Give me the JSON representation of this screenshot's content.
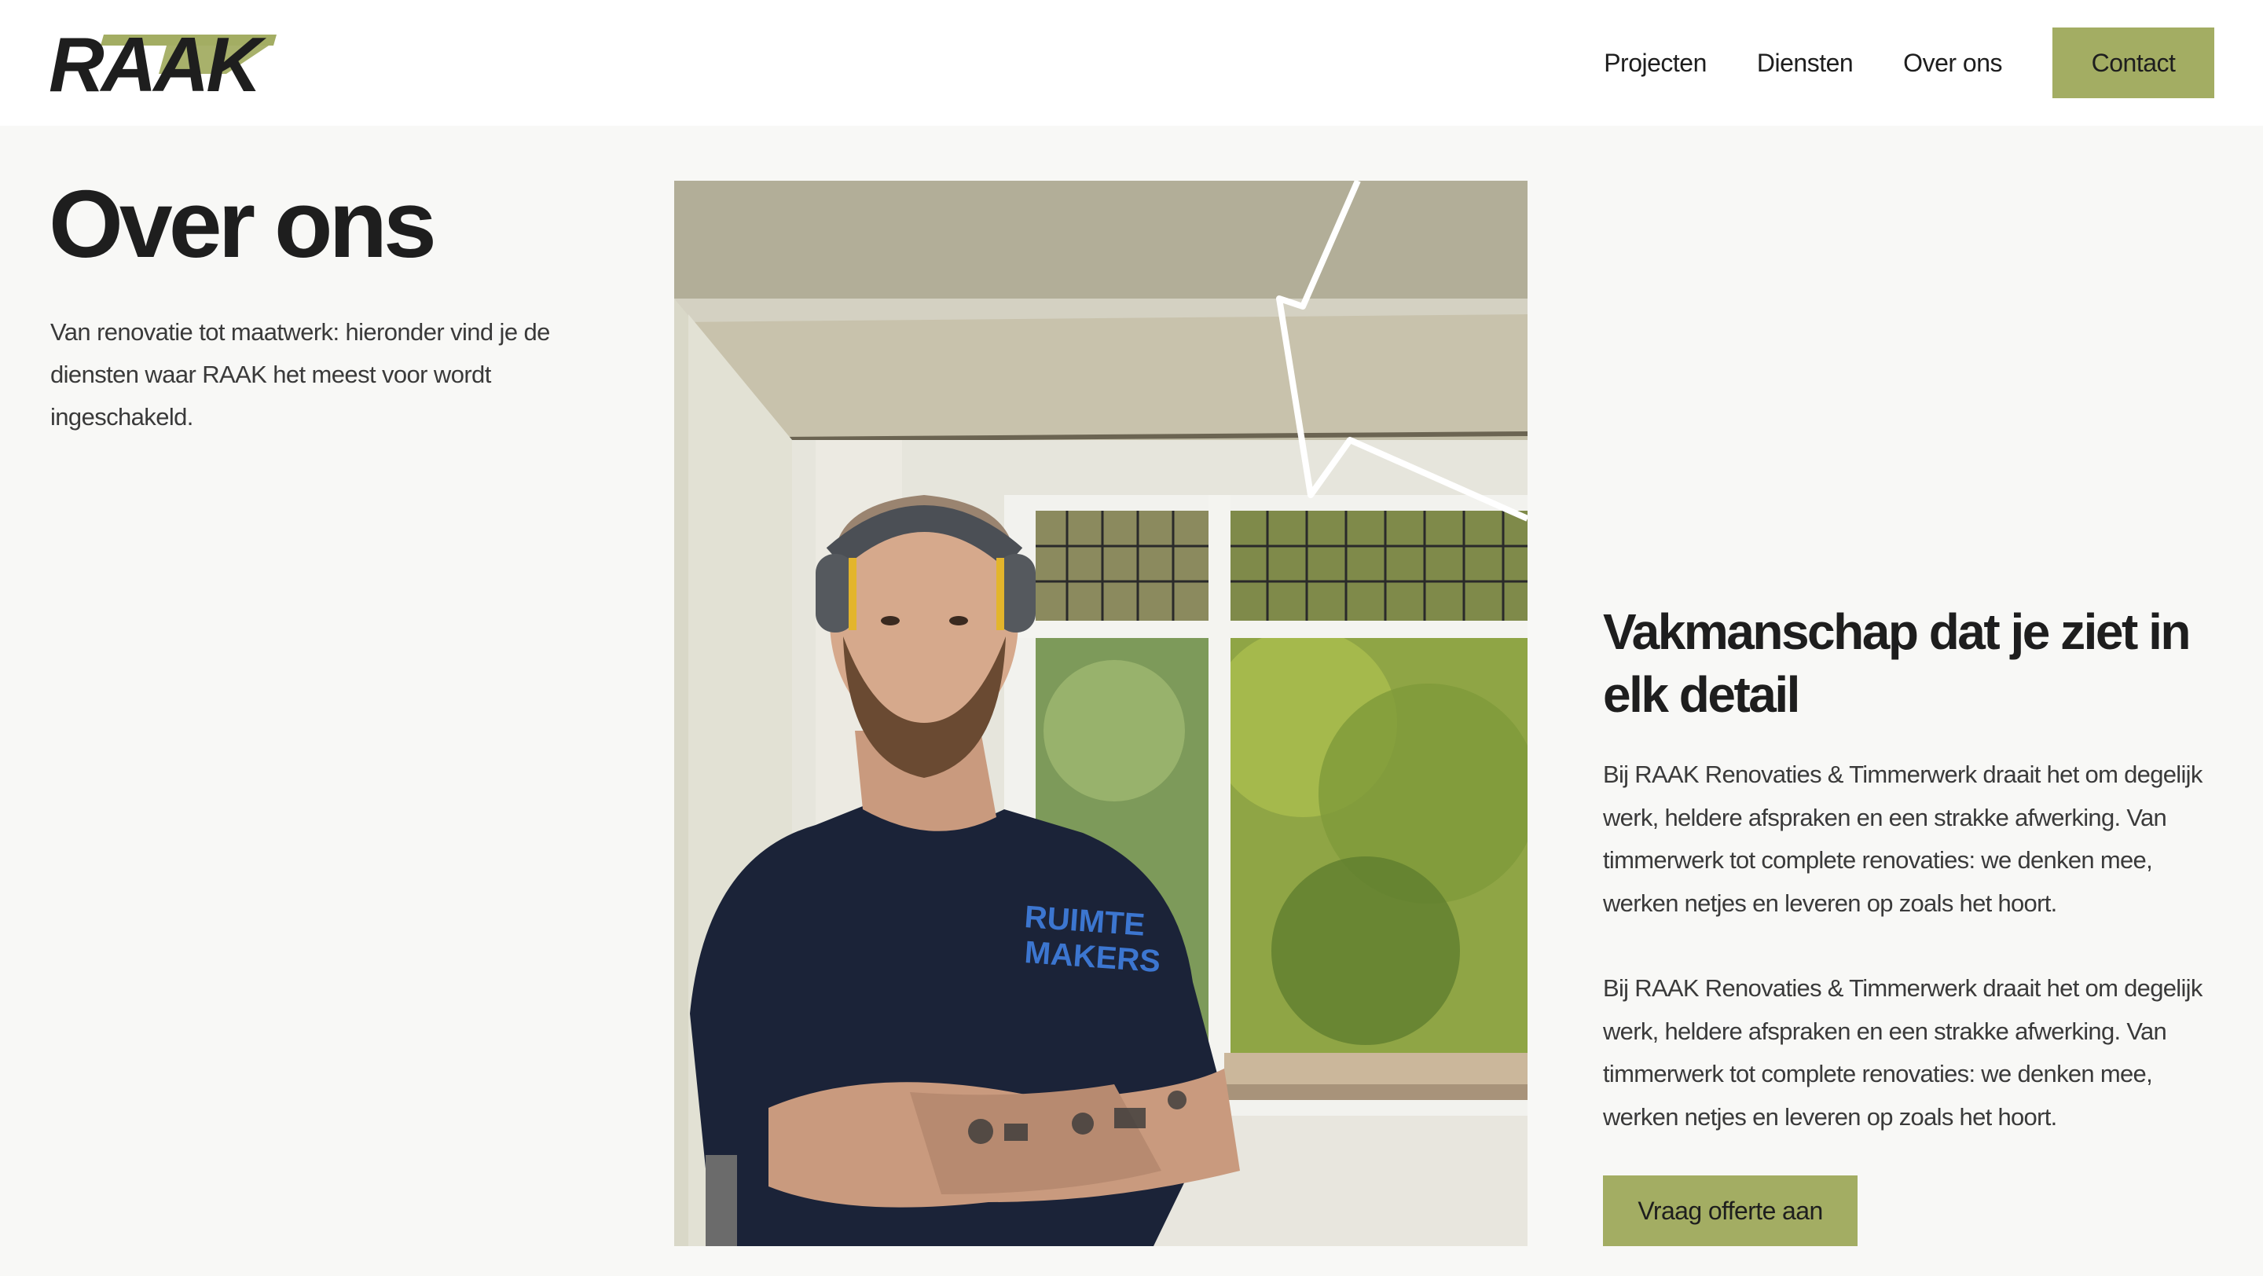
{
  "header": {
    "logo_text": "RAAK",
    "nav": [
      {
        "label": "Projecten"
      },
      {
        "label": "Diensten"
      },
      {
        "label": "Over ons"
      }
    ],
    "contact_label": "Contact"
  },
  "intro": {
    "title": "Over ons",
    "text": "Van renovatie tot maatwerk: hieronder vind je de diensten waar RAAK het meest voor wordt ingeschakeld."
  },
  "photo": {
    "shirt_text_line1": "RUIMTE",
    "shirt_text_line2": "MAKERS"
  },
  "about": {
    "heading": "Vakmanschap dat je ziet in elk detail",
    "paragraphs": [
      "Bij RAAK Renovaties & Timmerwerk draait het om degelijk werk, heldere afspraken en een strakke afwerking. Van timmerwerk tot complete renovaties: we denken mee, werken netjes en leveren op zoals het hoort.",
      "Bij RAAK Renovaties & Timmerwerk draait het om degelijk werk, heldere afspraken en een strakke afwerking. Van timmerwerk tot complete renovaties: we denken mee, werken netjes en leveren op zoals het hoort."
    ],
    "cta_label": "Vraag offerte aan"
  },
  "colors": {
    "accent": "#a3ad63",
    "background": "#f8f8f6",
    "header_bg": "#ffffff",
    "text": "#1e1e1e"
  }
}
